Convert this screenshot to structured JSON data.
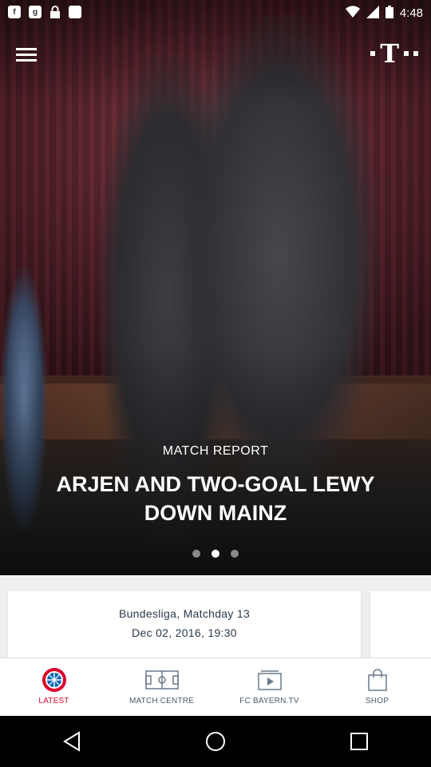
{
  "status_bar": {
    "time": "4:48",
    "notifications": [
      "f",
      "g",
      "lock",
      "app"
    ]
  },
  "hero": {
    "kicker": "MATCH REPORT",
    "headline": "ARJEN AND TWO-GOAL LEWY DOWN MAINZ",
    "slides": 3,
    "active_slide": 2,
    "sponsor_logo_glyph": "T"
  },
  "match_card": {
    "competition": "Bundesliga, Matchday 13",
    "date": "Dec 02, 2016, 19:30"
  },
  "tabs": [
    {
      "label": "LATEST",
      "icon": "fc-bayern-logo-icon",
      "active": true
    },
    {
      "label": "MATCH CENTRE",
      "icon": "pitch-icon",
      "active": false
    },
    {
      "label": "FC BAYERN.TV",
      "icon": "play-tv-icon",
      "active": false
    },
    {
      "label": "SHOP",
      "icon": "shopping-bag-icon",
      "active": false
    }
  ],
  "colors": {
    "accent": "#dc052d",
    "bayern_blue": "#0066b2",
    "tab_label": "#4a5a6a"
  }
}
